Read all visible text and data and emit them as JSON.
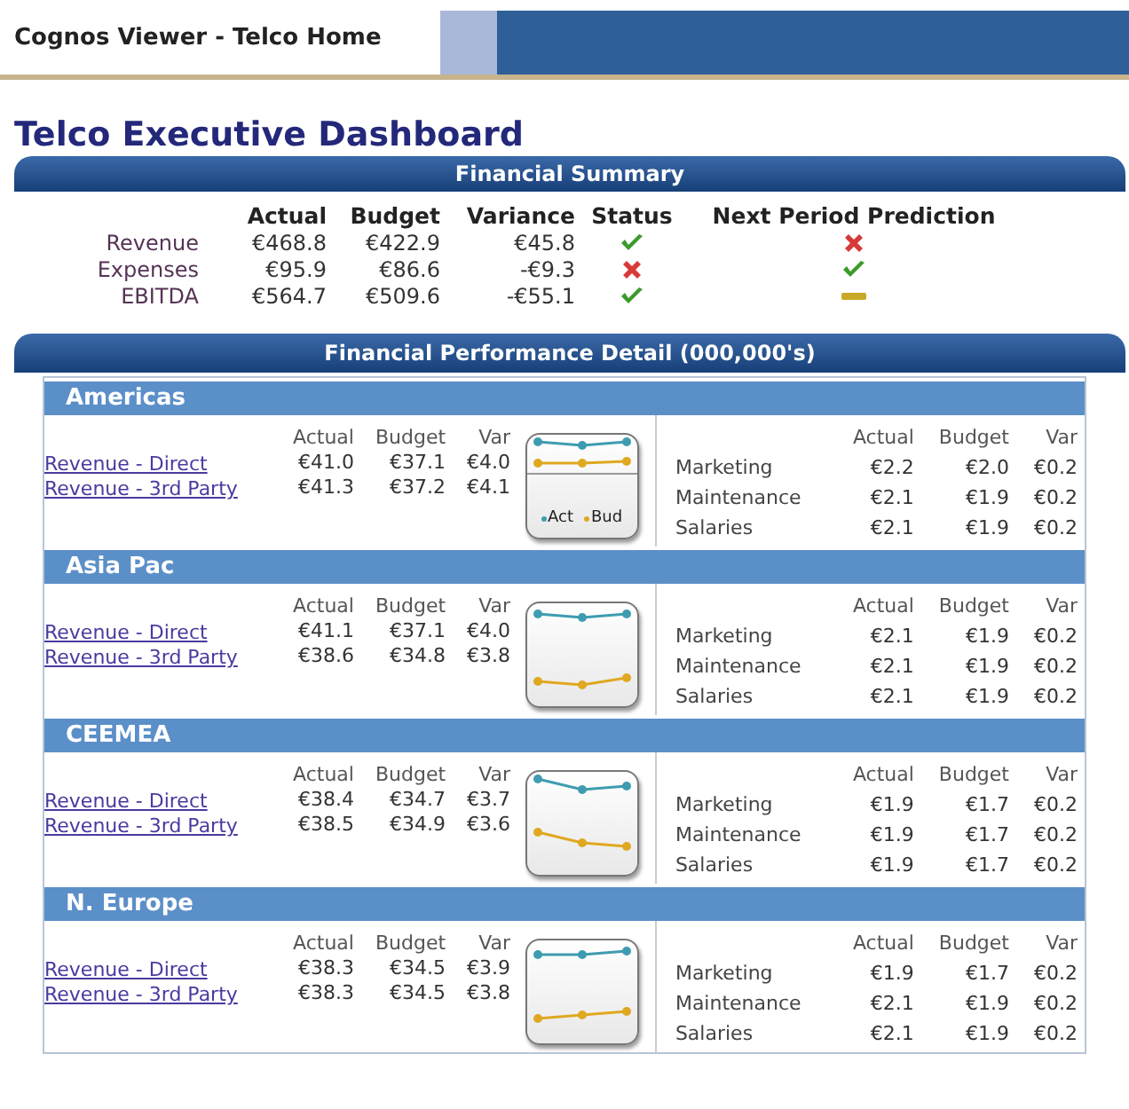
{
  "window": {
    "title": "Cognos Viewer - Telco Home"
  },
  "page_title": "Telco Executive Dashboard",
  "summary": {
    "title": "Financial Summary",
    "columns": [
      "Actual",
      "Budget",
      "Variance",
      "Status",
      "Next Period Prediction"
    ],
    "rows": [
      {
        "label": "Revenue",
        "actual": "€468.8",
        "budget": "€422.9",
        "variance": "€45.8",
        "status": {
          "kind": "good"
        },
        "prediction": {
          "kind": "bad"
        }
      },
      {
        "label": "Expenses",
        "actual": "€95.9",
        "budget": "€86.6",
        "variance": "-€9.3",
        "status": {
          "kind": "bad"
        },
        "prediction": {
          "kind": "good"
        }
      },
      {
        "label": "EBITDA",
        "actual": "€564.7",
        "budget": "€509.6",
        "variance": "-€55.1",
        "status": {
          "kind": "good"
        },
        "prediction": {
          "kind": "neutral"
        }
      }
    ]
  },
  "detail": {
    "title": "Financial Performance Detail  (000,000's)",
    "regions": [
      {
        "name": "Americas",
        "revenue_columns": [
          "Actual",
          "Budget",
          "Var"
        ],
        "revenue": [
          {
            "label": "Revenue - Direct",
            "actual": "€41.0",
            "budget": "€37.1",
            "var": "€4.0"
          },
          {
            "label": "Revenue - 3rd Party",
            "actual": "€41.3",
            "budget": "€37.2",
            "var": "€4.1"
          }
        ],
        "legend": [
          {
            "label": "Act",
            "color": "#3f9cb0"
          },
          {
            "label": "Bud",
            "color": "#e0a820"
          }
        ],
        "cost_columns": [
          "Actual",
          "Budget",
          "Var"
        ],
        "costs": [
          {
            "label": "Marketing",
            "actual": "€2.2",
            "budget": "€2.0",
            "var": "€0.2"
          },
          {
            "label": "Maintenance",
            "actual": "€2.1",
            "budget": "€1.9",
            "var": "€0.2"
          },
          {
            "label": "Salaries",
            "actual": "€2.1",
            "budget": "€1.9",
            "var": "€0.2"
          }
        ]
      },
      {
        "name": "Asia Pac",
        "revenue_columns": [
          "Actual",
          "Budget",
          "Var"
        ],
        "revenue": [
          {
            "label": "Revenue - Direct",
            "actual": "€41.1",
            "budget": "€37.1",
            "var": "€4.0"
          },
          {
            "label": "Revenue - 3rd Party",
            "actual": "€38.6",
            "budget": "€34.8",
            "var": "€3.8"
          }
        ],
        "cost_columns": [
          "Actual",
          "Budget",
          "Var"
        ],
        "costs": [
          {
            "label": "Marketing",
            "actual": "€2.1",
            "budget": "€1.9",
            "var": "€0.2"
          },
          {
            "label": "Maintenance",
            "actual": "€2.1",
            "budget": "€1.9",
            "var": "€0.2"
          },
          {
            "label": "Salaries",
            "actual": "€2.1",
            "budget": "€1.9",
            "var": "€0.2"
          }
        ]
      },
      {
        "name": "CEEMEA",
        "revenue_columns": [
          "Actual",
          "Budget",
          "Var"
        ],
        "revenue": [
          {
            "label": "Revenue - Direct",
            "actual": "€38.4",
            "budget": "€34.7",
            "var": "€3.7"
          },
          {
            "label": "Revenue - 3rd Party",
            "actual": "€38.5",
            "budget": "€34.9",
            "var": "€3.6"
          }
        ],
        "cost_columns": [
          "Actual",
          "Budget",
          "Var"
        ],
        "costs": [
          {
            "label": "Marketing",
            "actual": "€1.9",
            "budget": "€1.7",
            "var": "€0.2"
          },
          {
            "label": "Maintenance",
            "actual": "€1.9",
            "budget": "€1.7",
            "var": "€0.2"
          },
          {
            "label": "Salaries",
            "actual": "€1.9",
            "budget": "€1.7",
            "var": "€0.2"
          }
        ]
      },
      {
        "name": "N. Europe",
        "revenue_columns": [
          "Actual",
          "Budget",
          "Var"
        ],
        "revenue": [
          {
            "label": "Revenue - Direct",
            "actual": "€38.3",
            "budget": "€34.5",
            "var": "€3.9"
          },
          {
            "label": "Revenue - 3rd Party",
            "actual": "€38.3",
            "budget": "€34.5",
            "var": "€3.8"
          }
        ],
        "cost_columns": [
          "Actual",
          "Budget",
          "Var"
        ],
        "costs": [
          {
            "label": "Marketing",
            "actual": "€1.9",
            "budget": "€1.7",
            "var": "€0.2"
          },
          {
            "label": "Maintenance",
            "actual": "€2.1",
            "budget": "€1.9",
            "var": "€0.2"
          },
          {
            "label": "Salaries",
            "actual": "€2.1",
            "budget": "€1.9",
            "var": "€0.2"
          }
        ]
      }
    ]
  }
}
